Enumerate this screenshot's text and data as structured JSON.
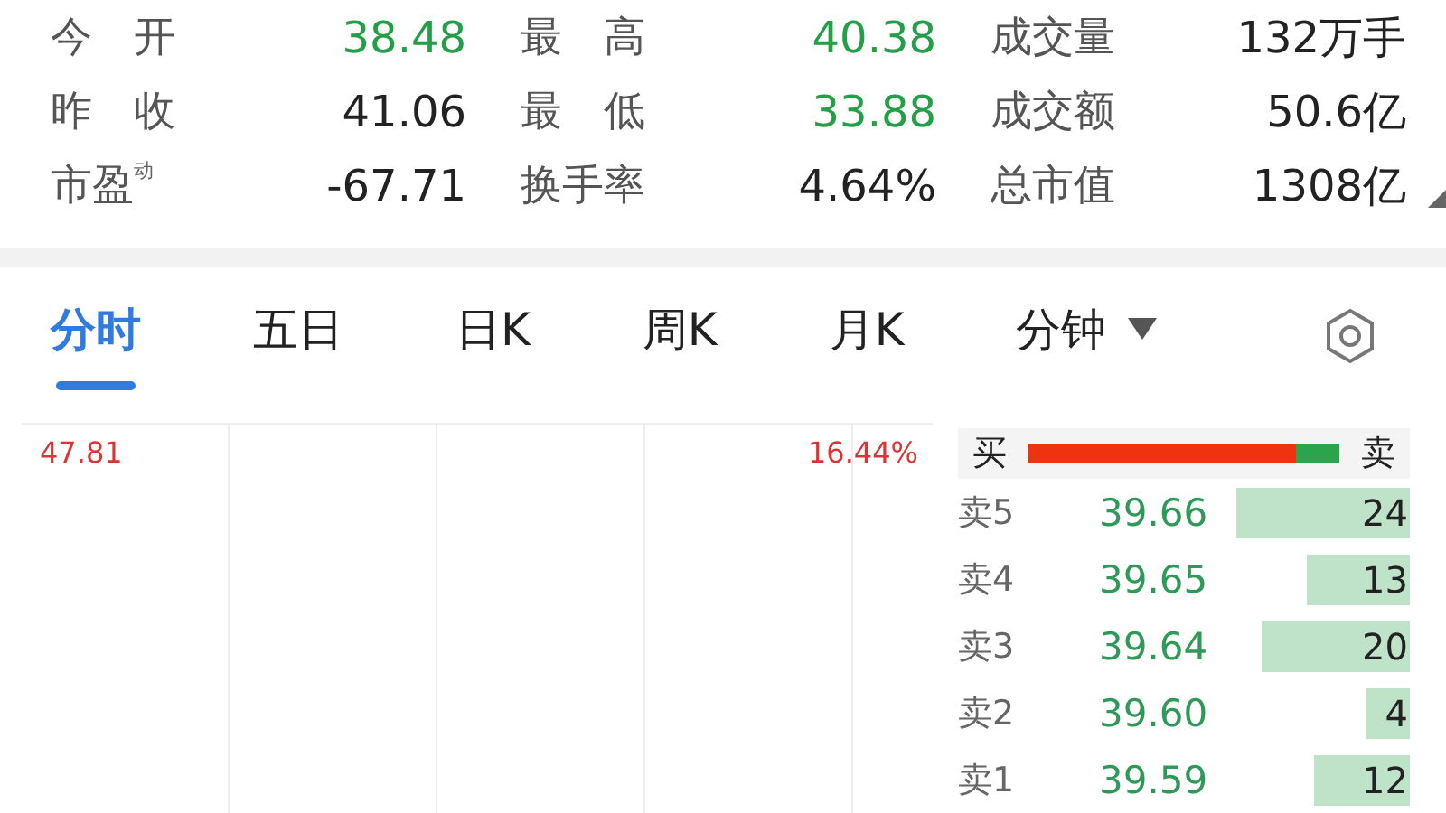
{
  "stats": [
    {
      "label": "今　开",
      "value": "38.48",
      "color": "#23a047"
    },
    {
      "label": "最　高",
      "value": "40.38",
      "color": "#23a047"
    },
    {
      "label": "成交量",
      "value": "132万手",
      "color": "#222222"
    },
    {
      "label": "昨　收",
      "value": "41.06",
      "color": "#222222"
    },
    {
      "label": "最　低",
      "value": "33.88",
      "color": "#23a047"
    },
    {
      "label": "成交额",
      "value": "50.6亿",
      "color": "#222222"
    },
    {
      "label": "市盈$^{动}$",
      "value": "-67.71",
      "color": "#222222"
    },
    {
      "label": "换手率",
      "value": "4.64%",
      "color": "#222222"
    },
    {
      "label": "总市值",
      "value": "1308亿",
      "color": "#222222"
    }
  ],
  "tabs": [
    {
      "label": "分时",
      "selected": true
    },
    {
      "label": "五日",
      "selected": false
    },
    {
      "label": "日K",
      "selected": false
    },
    {
      "label": "周K",
      "selected": false
    },
    {
      "label": "月K",
      "selected": false
    },
    {
      "label": "分钟",
      "selected": false,
      "dropdown": true
    }
  ],
  "chart": {
    "price_label": "47.81",
    "percent_label": "16.44%"
  },
  "order_book": {
    "buy_label": "买",
    "sell_label": "卖",
    "level": 0.86,
    "rows": [
      {
        "label": "卖5",
        "price": "39.66",
        "volume": "24"
      },
      {
        "label": "卖4",
        "price": "39.65",
        "volume": "13"
      },
      {
        "label": "卖3",
        "price": "39.64",
        "volume": "20"
      },
      {
        "label": "卖2",
        "price": "39.60",
        "volume": "4"
      },
      {
        "label": "卖1",
        "price": "39.59",
        "volume": "12"
      }
    ]
  }
}
